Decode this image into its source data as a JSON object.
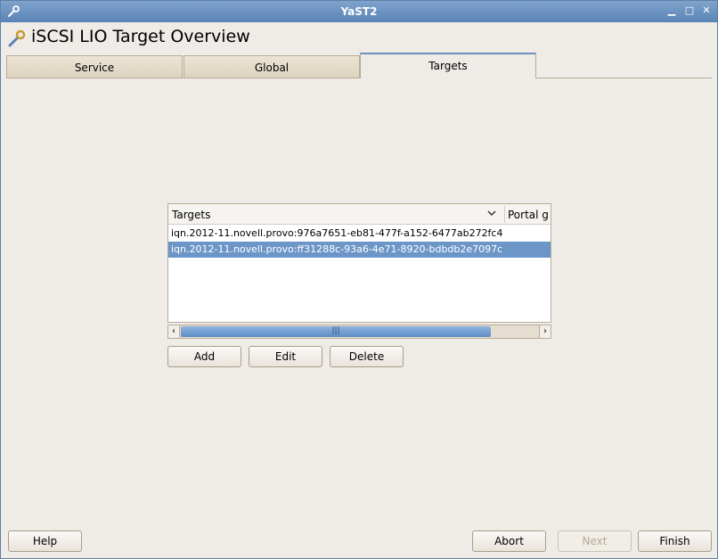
{
  "window": {
    "title": "YaST2"
  },
  "header": {
    "title": "iSCSI LIO Target Overview"
  },
  "tabs": [
    {
      "label": "Service",
      "mnemonic": "S"
    },
    {
      "label": "Global",
      "mnemonic": "G"
    },
    {
      "label": "Targets",
      "mnemonic": ""
    }
  ],
  "table": {
    "columns": [
      "Targets",
      "Portal g"
    ],
    "rows": [
      {
        "target": "iqn.2012-11.novell.provo:976a7651-eb81-477f-a152-6477ab272fc4",
        "selected": false
      },
      {
        "target": "iqn.2012-11.novell.provo:ff31288c-93a6-4e71-8920-bdbdb2e7097c",
        "selected": true
      }
    ]
  },
  "actions": {
    "add": "Add",
    "edit": "Edit",
    "delete": "Delete"
  },
  "footer": {
    "help": "Help",
    "abort": "Abort",
    "next": "Next",
    "finish": "Finish"
  },
  "colors": {
    "accent": "#6d96c8",
    "titlebar": "#5a83b5"
  }
}
